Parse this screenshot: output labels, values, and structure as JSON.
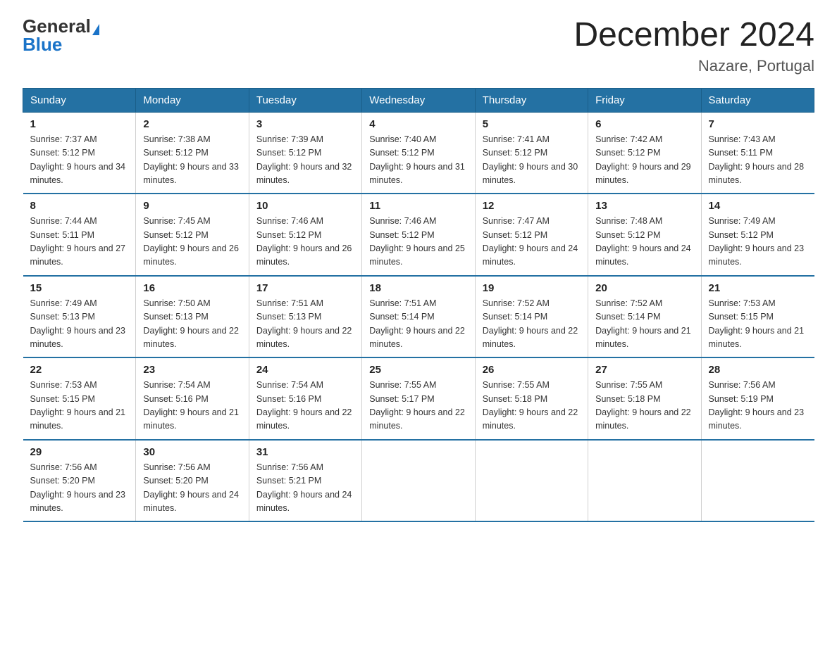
{
  "header": {
    "logo_general": "General",
    "logo_blue": "Blue",
    "month_title": "December 2024",
    "location": "Nazare, Portugal"
  },
  "days_of_week": [
    "Sunday",
    "Monday",
    "Tuesday",
    "Wednesday",
    "Thursday",
    "Friday",
    "Saturday"
  ],
  "weeks": [
    [
      {
        "num": "1",
        "sunrise": "7:37 AM",
        "sunset": "5:12 PM",
        "daylight": "9 hours and 34 minutes."
      },
      {
        "num": "2",
        "sunrise": "7:38 AM",
        "sunset": "5:12 PM",
        "daylight": "9 hours and 33 minutes."
      },
      {
        "num": "3",
        "sunrise": "7:39 AM",
        "sunset": "5:12 PM",
        "daylight": "9 hours and 32 minutes."
      },
      {
        "num": "4",
        "sunrise": "7:40 AM",
        "sunset": "5:12 PM",
        "daylight": "9 hours and 31 minutes."
      },
      {
        "num": "5",
        "sunrise": "7:41 AM",
        "sunset": "5:12 PM",
        "daylight": "9 hours and 30 minutes."
      },
      {
        "num": "6",
        "sunrise": "7:42 AM",
        "sunset": "5:12 PM",
        "daylight": "9 hours and 29 minutes."
      },
      {
        "num": "7",
        "sunrise": "7:43 AM",
        "sunset": "5:11 PM",
        "daylight": "9 hours and 28 minutes."
      }
    ],
    [
      {
        "num": "8",
        "sunrise": "7:44 AM",
        "sunset": "5:11 PM",
        "daylight": "9 hours and 27 minutes."
      },
      {
        "num": "9",
        "sunrise": "7:45 AM",
        "sunset": "5:12 PM",
        "daylight": "9 hours and 26 minutes."
      },
      {
        "num": "10",
        "sunrise": "7:46 AM",
        "sunset": "5:12 PM",
        "daylight": "9 hours and 26 minutes."
      },
      {
        "num": "11",
        "sunrise": "7:46 AM",
        "sunset": "5:12 PM",
        "daylight": "9 hours and 25 minutes."
      },
      {
        "num": "12",
        "sunrise": "7:47 AM",
        "sunset": "5:12 PM",
        "daylight": "9 hours and 24 minutes."
      },
      {
        "num": "13",
        "sunrise": "7:48 AM",
        "sunset": "5:12 PM",
        "daylight": "9 hours and 24 minutes."
      },
      {
        "num": "14",
        "sunrise": "7:49 AM",
        "sunset": "5:12 PM",
        "daylight": "9 hours and 23 minutes."
      }
    ],
    [
      {
        "num": "15",
        "sunrise": "7:49 AM",
        "sunset": "5:13 PM",
        "daylight": "9 hours and 23 minutes."
      },
      {
        "num": "16",
        "sunrise": "7:50 AM",
        "sunset": "5:13 PM",
        "daylight": "9 hours and 22 minutes."
      },
      {
        "num": "17",
        "sunrise": "7:51 AM",
        "sunset": "5:13 PM",
        "daylight": "9 hours and 22 minutes."
      },
      {
        "num": "18",
        "sunrise": "7:51 AM",
        "sunset": "5:14 PM",
        "daylight": "9 hours and 22 minutes."
      },
      {
        "num": "19",
        "sunrise": "7:52 AM",
        "sunset": "5:14 PM",
        "daylight": "9 hours and 22 minutes."
      },
      {
        "num": "20",
        "sunrise": "7:52 AM",
        "sunset": "5:14 PM",
        "daylight": "9 hours and 21 minutes."
      },
      {
        "num": "21",
        "sunrise": "7:53 AM",
        "sunset": "5:15 PM",
        "daylight": "9 hours and 21 minutes."
      }
    ],
    [
      {
        "num": "22",
        "sunrise": "7:53 AM",
        "sunset": "5:15 PM",
        "daylight": "9 hours and 21 minutes."
      },
      {
        "num": "23",
        "sunrise": "7:54 AM",
        "sunset": "5:16 PM",
        "daylight": "9 hours and 21 minutes."
      },
      {
        "num": "24",
        "sunrise": "7:54 AM",
        "sunset": "5:16 PM",
        "daylight": "9 hours and 22 minutes."
      },
      {
        "num": "25",
        "sunrise": "7:55 AM",
        "sunset": "5:17 PM",
        "daylight": "9 hours and 22 minutes."
      },
      {
        "num": "26",
        "sunrise": "7:55 AM",
        "sunset": "5:18 PM",
        "daylight": "9 hours and 22 minutes."
      },
      {
        "num": "27",
        "sunrise": "7:55 AM",
        "sunset": "5:18 PM",
        "daylight": "9 hours and 22 minutes."
      },
      {
        "num": "28",
        "sunrise": "7:56 AM",
        "sunset": "5:19 PM",
        "daylight": "9 hours and 23 minutes."
      }
    ],
    [
      {
        "num": "29",
        "sunrise": "7:56 AM",
        "sunset": "5:20 PM",
        "daylight": "9 hours and 23 minutes."
      },
      {
        "num": "30",
        "sunrise": "7:56 AM",
        "sunset": "5:20 PM",
        "daylight": "9 hours and 24 minutes."
      },
      {
        "num": "31",
        "sunrise": "7:56 AM",
        "sunset": "5:21 PM",
        "daylight": "9 hours and 24 minutes."
      },
      {
        "num": "",
        "sunrise": "",
        "sunset": "",
        "daylight": ""
      },
      {
        "num": "",
        "sunrise": "",
        "sunset": "",
        "daylight": ""
      },
      {
        "num": "",
        "sunrise": "",
        "sunset": "",
        "daylight": ""
      },
      {
        "num": "",
        "sunrise": "",
        "sunset": "",
        "daylight": ""
      }
    ]
  ],
  "labels": {
    "sunrise_prefix": "Sunrise: ",
    "sunset_prefix": "Sunset: ",
    "daylight_prefix": "Daylight: "
  }
}
